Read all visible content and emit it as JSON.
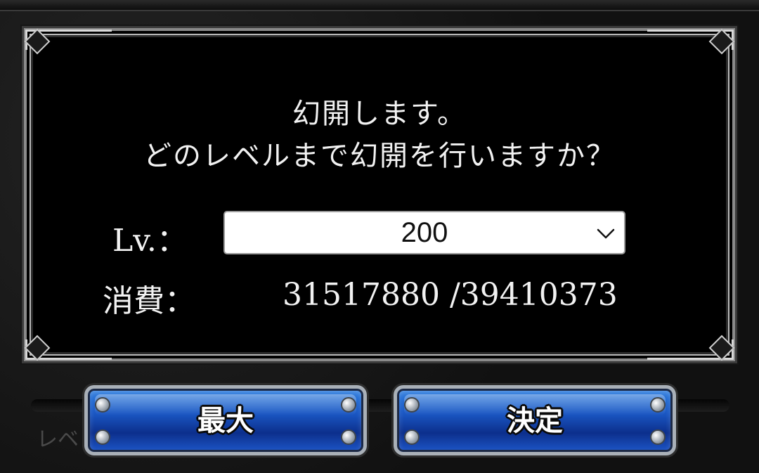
{
  "dialog": {
    "message_line1": "幻開します。",
    "message_line2": "どのレベルまで幻開を行いますか？",
    "level_label": "Lv.：",
    "level_select": {
      "value": "200",
      "icon": "chevron-down-icon"
    },
    "cost_label": "消費：",
    "cost_value": "31517880 /39410373"
  },
  "buttons": {
    "max_label": "最大",
    "confirm_label": "決定"
  },
  "background": {
    "partial_text": "レベ"
  },
  "colors": {
    "dialog_bg": "#000000",
    "frame_silver": "#b9b9b9",
    "button_blue": "#1a56c2",
    "text_white": "#f2f2f2"
  }
}
